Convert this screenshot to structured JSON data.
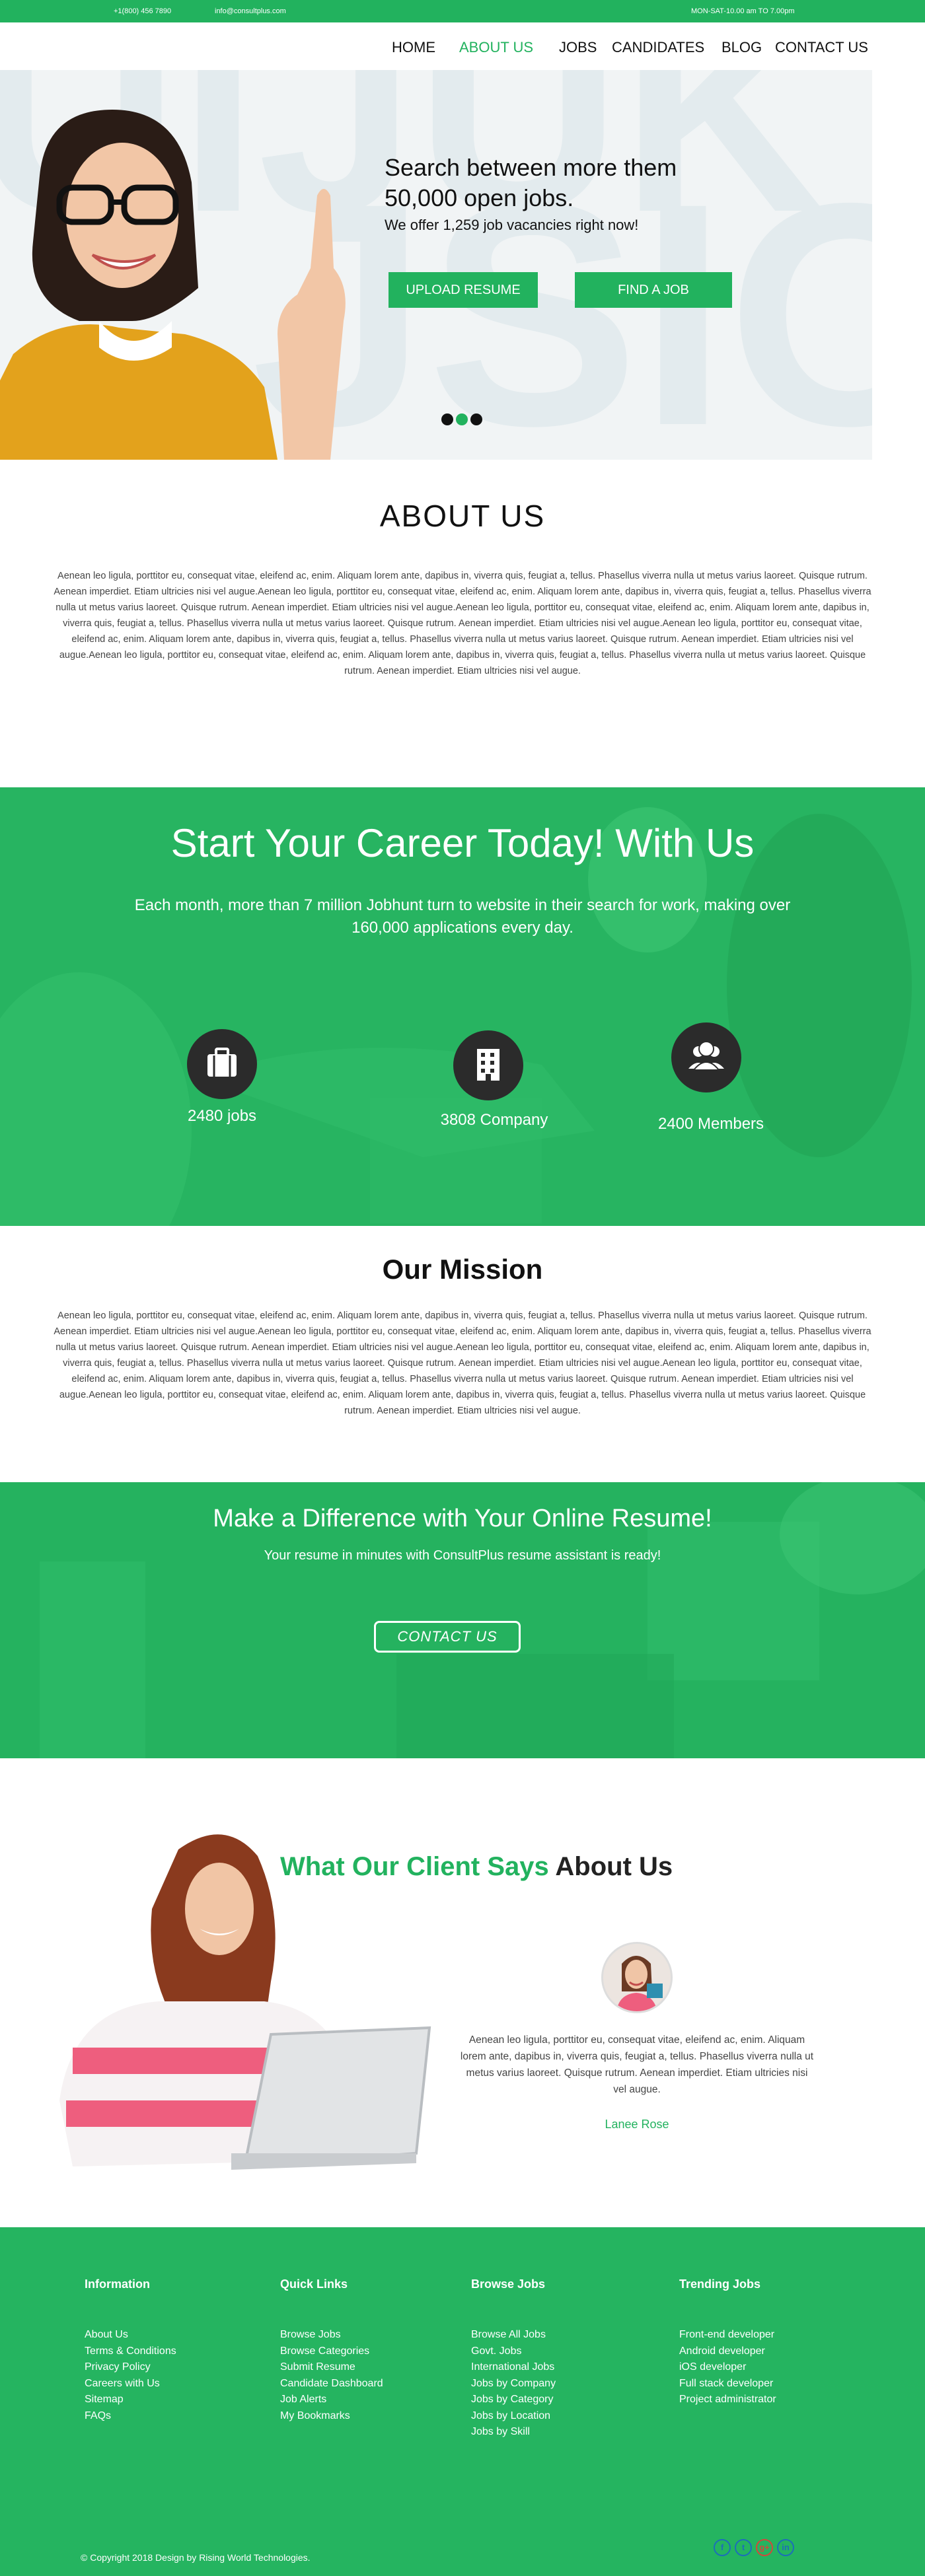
{
  "topbar": {
    "phone": "+1(800) 456 7890",
    "email": "info@consultplus.com",
    "hours": "MON-SAT-10.00 am TO 7.00pm"
  },
  "nav": {
    "items": [
      {
        "label": "HOME"
      },
      {
        "label": "ABOUT US",
        "active": true
      },
      {
        "label": "JOBS"
      },
      {
        "label": "CANDIDATES"
      },
      {
        "label": "BLOG"
      },
      {
        "label": "CONTACT US"
      }
    ]
  },
  "hero": {
    "title_line1": "Search between more them",
    "title_line2": "50,000 open jobs.",
    "subtitle": "We offer 1,259 job vacancies right now!",
    "upload_button": "UPLOAD RESUME",
    "find_button": "FIND A JOB",
    "slides": 3,
    "active_slide": 2
  },
  "about": {
    "title": "ABOUT US",
    "text": "Aenean leo ligula, porttitor eu, consequat vitae, eleifend ac, enim. Aliquam lorem ante, dapibus in, viverra quis, feugiat a, tellus. Phasellus viverra nulla ut metus varius laoreet. Quisque rutrum. Aenean imperdiet. Etiam ultricies nisi vel augue.Aenean leo ligula, porttitor eu, consequat vitae, eleifend ac, enim. Aliquam lorem ante, dapibus in, viverra quis, feugiat a, tellus. Phasellus viverra nulla ut metus varius laoreet. Quisque rutrum. Aenean imperdiet. Etiam ultricies nisi vel augue.Aenean leo ligula, porttitor eu, consequat vitae, eleifend ac, enim. Aliquam lorem ante, dapibus in, viverra quis, feugiat a, tellus. Phasellus viverra nulla ut metus varius laoreet. Quisque rutrum. Aenean imperdiet. Etiam ultricies nisi vel augue.Aenean leo ligula, porttitor eu, consequat vitae, eleifend ac, enim. Aliquam lorem ante, dapibus in, viverra quis, feugiat a, tellus. Phasellus viverra nulla ut metus varius laoreet. Quisque rutrum. Aenean imperdiet. Etiam ultricies nisi vel augue.Aenean leo ligula, porttitor eu, consequat vitae, eleifend ac, enim. Aliquam lorem ante, dapibus in, viverra quis, feugiat a, tellus. Phasellus viverra nulla ut metus varius laoreet. Quisque rutrum. Aenean imperdiet. Etiam ultricies nisi vel augue."
  },
  "career": {
    "title": "Start Your Career Today! With Us",
    "subtitle": "Each month, more than 7 million Jobhunt turn to website in their search for work, making over 160,000 applications every day.",
    "stats": [
      {
        "icon": "briefcase-icon",
        "label": "2480 jobs"
      },
      {
        "icon": "building-icon",
        "label": "3808 Company"
      },
      {
        "icon": "members-icon",
        "label": "2400 Members"
      }
    ]
  },
  "mission": {
    "title": "Our Mission",
    "text": "Aenean leo ligula, porttitor eu, consequat vitae, eleifend ac, enim. Aliquam lorem ante, dapibus in, viverra quis, feugiat a, tellus. Phasellus viverra nulla ut metus varius laoreet. Quisque rutrum. Aenean imperdiet. Etiam ultricies nisi vel augue.Aenean leo ligula, porttitor eu, consequat vitae, eleifend ac, enim. Aliquam lorem ante, dapibus in, viverra quis, feugiat a, tellus. Phasellus viverra nulla ut metus varius laoreet. Quisque rutrum. Aenean imperdiet. Etiam ultricies nisi vel augue.Aenean leo ligula, porttitor eu, consequat vitae, eleifend ac, enim. Aliquam lorem ante, dapibus in, viverra quis, feugiat a, tellus. Phasellus viverra nulla ut metus varius laoreet. Quisque rutrum. Aenean imperdiet. Etiam ultricies nisi vel augue.Aenean leo ligula, porttitor eu, consequat vitae, eleifend ac, enim. Aliquam lorem ante, dapibus in, viverra quis, feugiat a, tellus. Phasellus viverra nulla ut metus varius laoreet. Quisque rutrum. Aenean imperdiet. Etiam ultricies nisi vel augue.Aenean leo ligula, porttitor eu, consequat vitae, eleifend ac, enim. Aliquam lorem ante, dapibus in, viverra quis, feugiat a, tellus. Phasellus viverra nulla ut metus varius laoreet. Quisque rutrum. Aenean imperdiet. Etiam ultricies nisi vel augue."
  },
  "resume": {
    "title": "Make a Difference with Your Online Resume!",
    "subtitle": "Your resume in minutes with ConsultPlus resume assistant is ready!",
    "button": "CONTACT US"
  },
  "testimonial": {
    "title_green": "What Our Client Says",
    "title_dark": "About Us",
    "text": "Aenean leo ligula, porttitor eu, consequat vitae, eleifend ac, enim. Aliquam lorem ante, dapibus in, viverra quis, feugiat a, tellus. Phasellus viverra nulla ut metus varius laoreet. Quisque rutrum. Aenean imperdiet. Etiam ultricies nisi vel augue.",
    "name": "Lanee Rose"
  },
  "footer": {
    "columns": [
      {
        "title": "Information",
        "items": [
          "About Us",
          "Terms & Conditions",
          "Privacy Policy",
          "Careers with Us",
          "Sitemap",
          "FAQs"
        ]
      },
      {
        "title": "Quick Links",
        "items": [
          "Browse Jobs",
          "Browse Categories",
          "Submit Resume",
          "Candidate Dashboard",
          "Job Alerts",
          "My Bookmarks"
        ]
      },
      {
        "title": "Browse Jobs",
        "items": [
          "Browse All Jobs",
          "Govt. Jobs",
          "International Jobs",
          "Jobs by Company",
          "Jobs by Category",
          "Jobs by Location",
          "Jobs by Skill"
        ]
      },
      {
        "title": "Trending Jobs",
        "items": [
          "Front-end developer",
          "Android developer",
          "iOS developer",
          "Full stack developer",
          "Project administrator"
        ]
      }
    ],
    "copyright": "© Copyright 2018 Design by Rising World Technologies.",
    "social": [
      "facebook-icon",
      "twitter-icon",
      "google-plus-icon",
      "linkedin-icon"
    ]
  },
  "colors": {
    "brand_green": "#22b25e",
    "dark": "#111111",
    "social_blue": "#1c6fb8"
  }
}
